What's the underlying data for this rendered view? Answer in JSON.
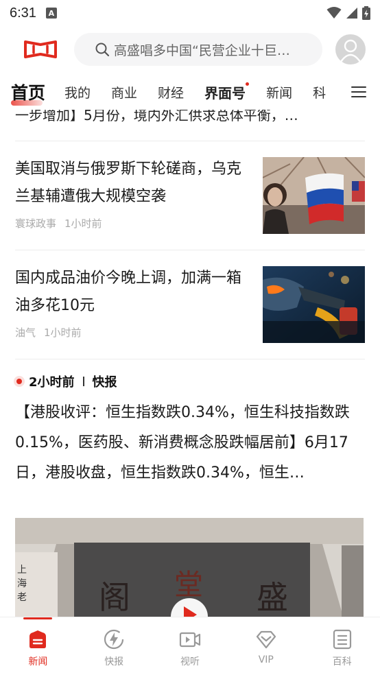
{
  "status_bar": {
    "time": "6:31",
    "notification_letter": "A"
  },
  "header": {
    "logo": "jiemian-logo",
    "search_placeholder": "高盛唱多中国“民营企业十巨…",
    "avatar": "user-avatar"
  },
  "tabs": [
    {
      "label": "首页",
      "active": true
    },
    {
      "label": "我的"
    },
    {
      "label": "商业"
    },
    {
      "label": "财经"
    },
    {
      "label": "界面号",
      "bold": true,
      "dot": true
    },
    {
      "label": "新闻"
    },
    {
      "label": "科"
    }
  ],
  "feed": {
    "partial_text": "一步增加】5月份，境内外汇供求总体平衡，…",
    "items": [
      {
        "title": "美国取消与俄罗斯下轮磋商，乌克兰基辅遭俄大规模空袭",
        "source": "寰球政事",
        "time": "1小时前",
        "thumb": "flags-photo"
      },
      {
        "title": "国内成品油价今晚上调，加满一箱油多花10元",
        "source": "油气",
        "time": "1小时前",
        "thumb": "fuel-nozzle-photo"
      }
    ],
    "flash": {
      "time": "2小时前",
      "tag": "快报",
      "body": "【港股收评：恒生指数跌0.34%，恒生科技指数跌0.15%，医药股、新消费概念股跌幅居前】6月17日，港股收盘，恒生指数跌0.34%，恒生…"
    },
    "video_sign": {
      "chars": [
        "上",
        "海",
        "老"
      ],
      "big": [
        "阁",
        "堂",
        "盛"
      ]
    }
  },
  "bottom_nav": [
    {
      "label": "新闻",
      "icon": "news-icon",
      "active": true
    },
    {
      "label": "快报",
      "icon": "flash-icon"
    },
    {
      "label": "视听",
      "icon": "video-icon"
    },
    {
      "label": "VIP",
      "icon": "vip-diamond-icon"
    },
    {
      "label": "百科",
      "icon": "encyclopedia-icon"
    }
  ],
  "colors": {
    "accent": "#e02a1e",
    "text": "#1a1a1a",
    "meta": "#aaaaaa"
  }
}
